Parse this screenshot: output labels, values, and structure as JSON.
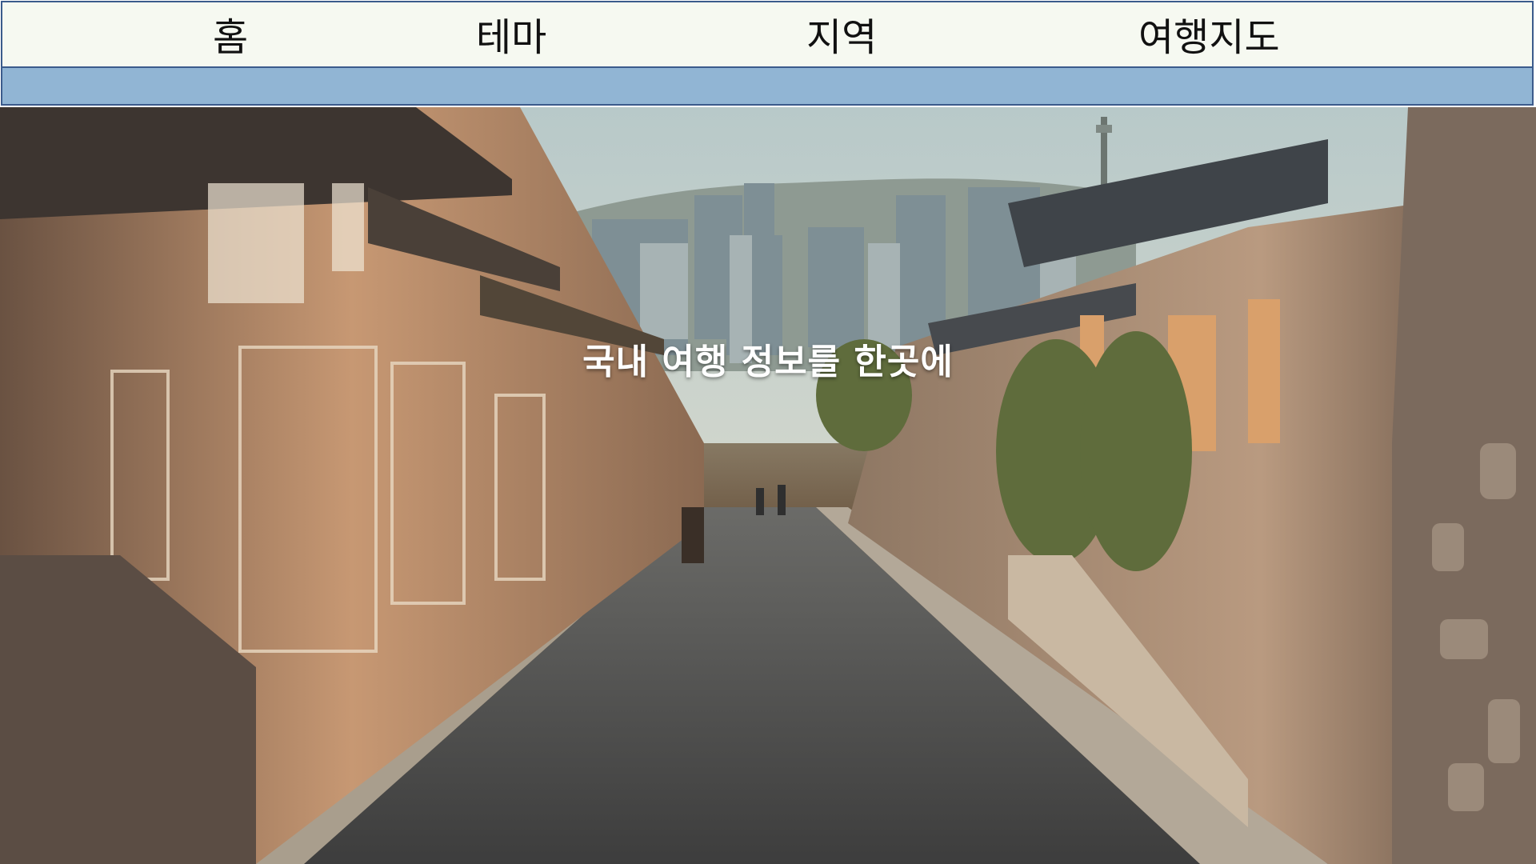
{
  "nav": {
    "items": [
      {
        "label": "홈"
      },
      {
        "label": "테마"
      },
      {
        "label": "지역"
      },
      {
        "label": "여행지도"
      }
    ]
  },
  "hero": {
    "title": "국내 여행 정보를 한곳에"
  },
  "colors": {
    "nav_background": "#f6f9f1",
    "nav_border": "#3b5b8c",
    "sub_bar": "#91b5d4",
    "hero_text": "#ffffff"
  }
}
